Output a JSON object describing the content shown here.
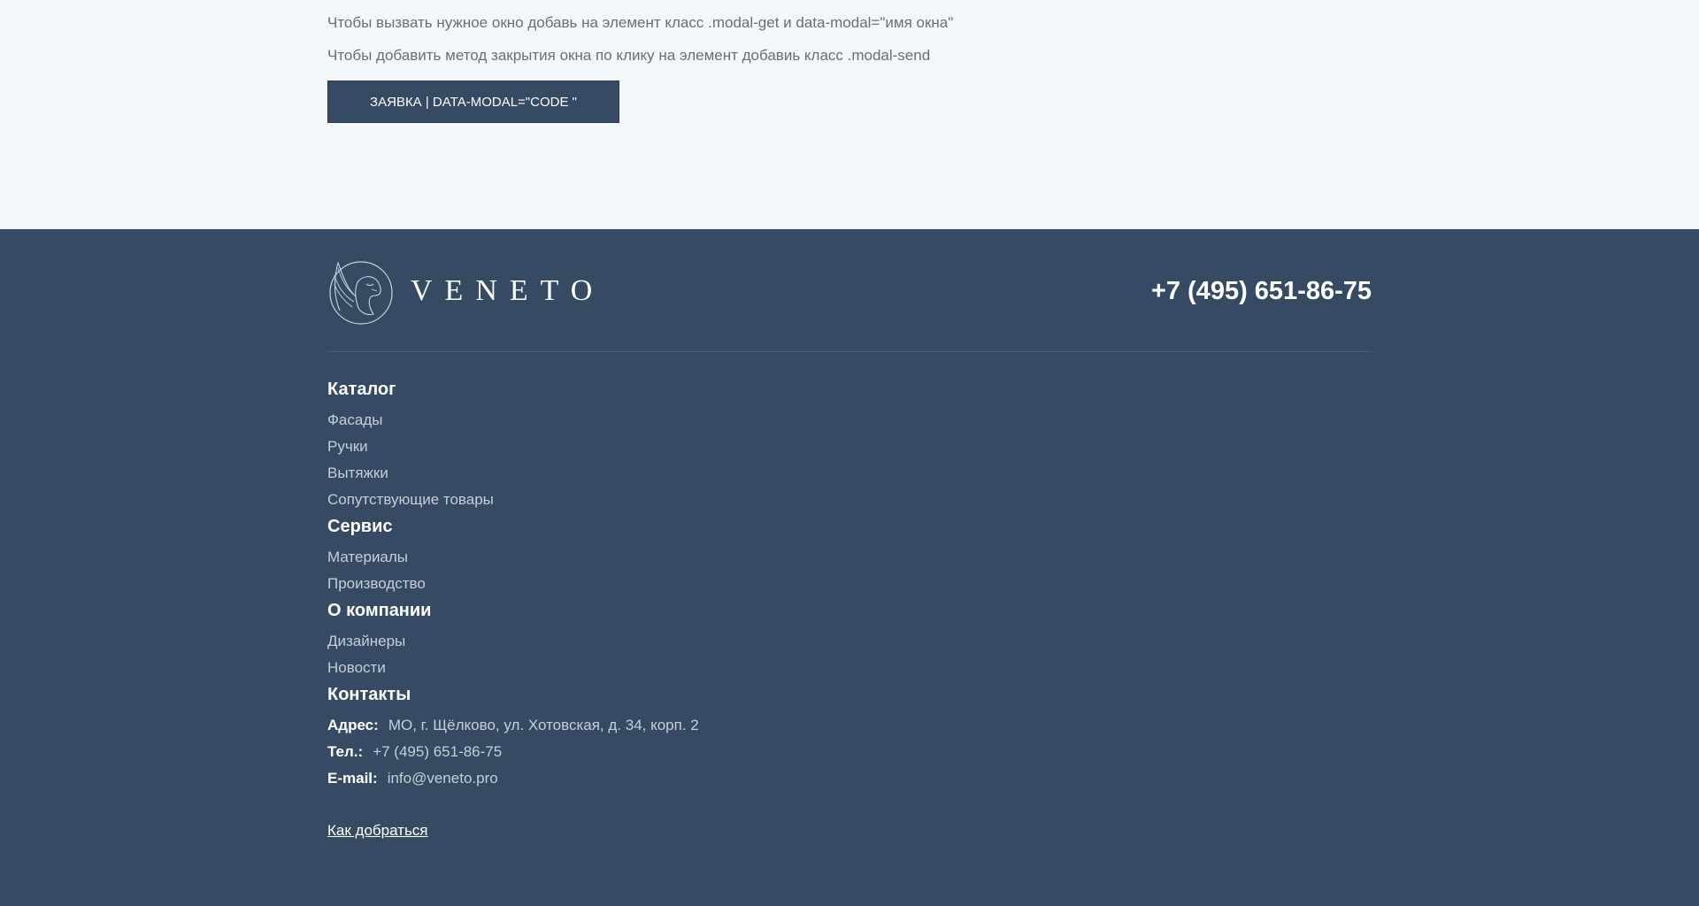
{
  "hints": {
    "line1": "Чтобы вызвать нужное окно добавь на элемент класс .modal-get и data-modal=\"имя окна\"",
    "line2": "Чтобы добавить метод закрытия окна по клику на элемент добавиь класс .modal-send"
  },
  "cta": {
    "label": "ЗАЯВКА | DATA-MODAL=\"CODE \""
  },
  "footer": {
    "logo_text": "VENETO",
    "phone": "+7 (495) 651-86-75",
    "catalog": {
      "title": "Каталог",
      "items": [
        "Фасады",
        "Ручки",
        "Вытяжки",
        "Сопутствующие товары"
      ]
    },
    "service": {
      "title": "Сервис",
      "items": [
        "Материалы",
        "Производство"
      ]
    },
    "company": {
      "title": "О компании",
      "items": [
        "Дизайнеры",
        "Новости"
      ]
    },
    "contacts": {
      "title": "Контакты",
      "address_label": "Адрес:",
      "address": "МО, г. Щёлково, ул. Хотовская, д. 34, корп. 2",
      "phone_label": "Тел.:",
      "phone": "+7 (495) 651-86-75",
      "email_label": "E-mail:",
      "email": "info@veneto.pro"
    },
    "route_link": "Как добраться"
  },
  "colors": {
    "footer_bg": "#364a63",
    "page_bg": "#f3f7fa",
    "button_bg": "#364a63"
  },
  "icons": {
    "logo": "winged-lion-emblem-icon"
  }
}
